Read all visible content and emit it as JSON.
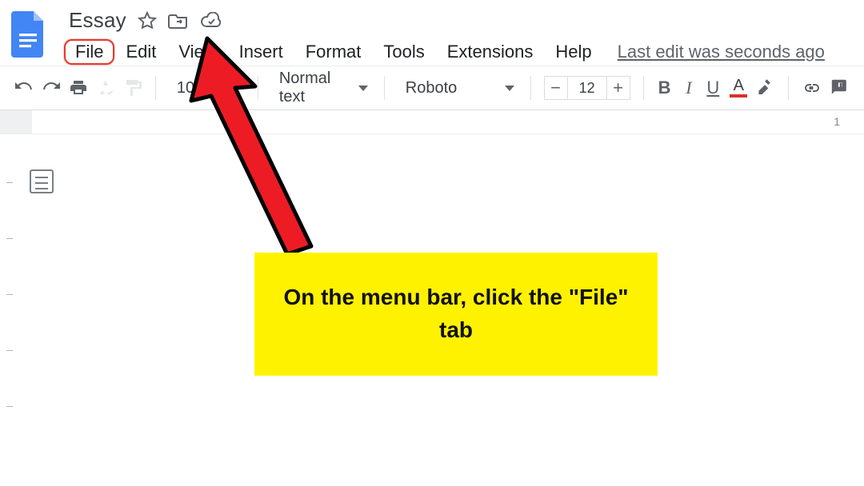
{
  "header": {
    "doc_title": "Essay",
    "menus": [
      "File",
      "Edit",
      "View",
      "Insert",
      "Format",
      "Tools",
      "Extensions",
      "Help"
    ],
    "last_edit": "Last edit was seconds ago"
  },
  "toolbar": {
    "zoom": "100%",
    "paragraph_style": "Normal text",
    "font_family": "Roboto",
    "font_size": "12"
  },
  "ruler": {
    "marker": "1"
  },
  "annotation": {
    "text": "On the menu bar, click the \"File\" tab"
  }
}
